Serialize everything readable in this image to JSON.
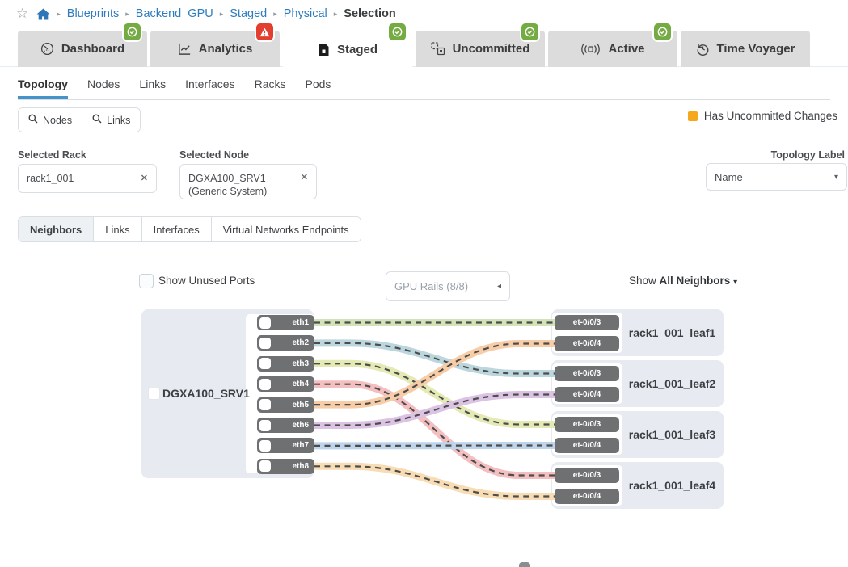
{
  "breadcrumb": {
    "links": [
      "Blueprints",
      "Backend_GPU",
      "Staged",
      "Physical"
    ],
    "current": "Selection"
  },
  "tabs": [
    {
      "label": "Dashboard",
      "icon": "gauge-icon",
      "badge": "success",
      "active": false
    },
    {
      "label": "Analytics",
      "icon": "analytics-icon",
      "badge": "warning",
      "active": false
    },
    {
      "label": "Staged",
      "icon": "staged-icon",
      "badge": "success",
      "active": true
    },
    {
      "label": "Uncommitted",
      "icon": "uncommitted-icon",
      "badge": "success",
      "active": false
    },
    {
      "label": "Active",
      "icon": "active-icon",
      "badge": "success",
      "active": false
    },
    {
      "label": "Time Voyager",
      "icon": "time-voyager-icon",
      "badge": "none",
      "active": false
    }
  ],
  "subtabs": [
    {
      "label": "Topology",
      "active": true
    },
    {
      "label": "Nodes",
      "active": false
    },
    {
      "label": "Links",
      "active": false
    },
    {
      "label": "Interfaces",
      "active": false
    },
    {
      "label": "Racks",
      "active": false
    },
    {
      "label": "Pods",
      "active": false
    }
  ],
  "search_buttons": [
    {
      "label": "Nodes"
    },
    {
      "label": "Links"
    }
  ],
  "legend": {
    "label": "Has Uncommitted Changes",
    "color": "#f6a81c"
  },
  "selected_rack": {
    "label": "Selected Rack",
    "value": "rack1_001"
  },
  "selected_node": {
    "label": "Selected Node",
    "value": "DGXA100_SRV1 (Generic System)"
  },
  "topology_label": {
    "label": "Topology Label",
    "value": "Name"
  },
  "view_tabs": [
    {
      "label": "Neighbors",
      "active": true
    },
    {
      "label": "Links",
      "active": false
    },
    {
      "label": "Interfaces",
      "active": false
    },
    {
      "label": "Virtual Networks Endpoints",
      "active": false
    }
  ],
  "controls": {
    "show_unused_ports": "Show Unused Ports",
    "gpu_rails": "GPU Rails (8/8)",
    "show_neighbors_prefix": "Show",
    "show_neighbors_value": "All Neighbors"
  },
  "diagram": {
    "server": {
      "name": "DGXA100_SRV1",
      "ports": [
        "eth1",
        "eth2",
        "eth3",
        "eth4",
        "eth5",
        "eth6",
        "eth7",
        "eth8"
      ]
    },
    "leaves": [
      {
        "name": "rack1_001_leaf1",
        "ports": [
          "et-0/0/3",
          "et-0/0/4"
        ]
      },
      {
        "name": "rack1_001_leaf2",
        "ports": [
          "et-0/0/3",
          "et-0/0/4"
        ]
      },
      {
        "name": "rack1_001_leaf3",
        "ports": [
          "et-0/0/3",
          "et-0/0/4"
        ]
      },
      {
        "name": "rack1_001_leaf4",
        "ports": [
          "et-0/0/3",
          "et-0/0/4"
        ]
      }
    ],
    "links": [
      {
        "from": "eth1",
        "to_leaf": 0,
        "to_port": 0,
        "color": "#d3e3b8"
      },
      {
        "from": "eth2",
        "to_leaf": 1,
        "to_port": 0,
        "color": "#bcd6dd"
      },
      {
        "from": "eth3",
        "to_leaf": 2,
        "to_port": 0,
        "color": "#e5eab5"
      },
      {
        "from": "eth4",
        "to_leaf": 3,
        "to_port": 0,
        "color": "#f3bfc0"
      },
      {
        "from": "eth5",
        "to_leaf": 0,
        "to_port": 1,
        "color": "#f7cda8"
      },
      {
        "from": "eth6",
        "to_leaf": 1,
        "to_port": 1,
        "color": "#dcc3e4"
      },
      {
        "from": "eth7",
        "to_leaf": 2,
        "to_port": 1,
        "color": "#bed4ea"
      },
      {
        "from": "eth8",
        "to_leaf": 3,
        "to_port": 1,
        "color": "#f8dcb4"
      }
    ]
  }
}
